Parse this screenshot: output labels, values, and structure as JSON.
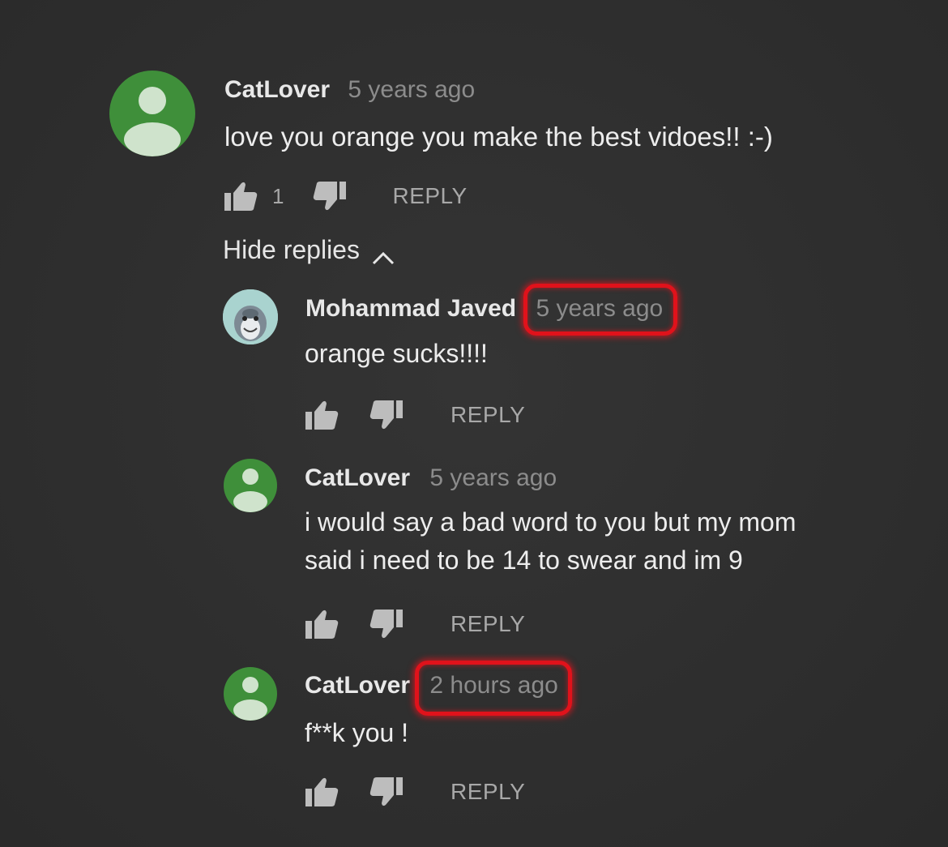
{
  "comments": [
    {
      "author": "CatLover",
      "time": "5 years ago",
      "text": "love you orange you make the best vidoes!! :-)",
      "like_count": "1",
      "reply_label": "REPLY",
      "avatar": "default-user-avatar"
    }
  ],
  "hide_replies_label": "Hide replies",
  "replies": [
    {
      "author": "Mohammad Javed",
      "time": "5 years ago",
      "text_lines": [
        "orange sucks!!!!"
      ],
      "reply_label": "REPLY",
      "avatar": "dolphin-photo-avatar",
      "time_highlighted": true
    },
    {
      "author": "CatLover",
      "time": "5 years ago",
      "text_lines": [
        "i would say a bad word to you but my mom",
        "said i need to be 14 to swear and im 9"
      ],
      "reply_label": "REPLY",
      "avatar": "default-user-avatar",
      "time_highlighted": false
    },
    {
      "author": "CatLover",
      "time": "2 hours ago",
      "text_lines": [
        "f**k you !"
      ],
      "reply_label": "REPLY",
      "avatar": "default-user-avatar",
      "time_highlighted": true
    }
  ],
  "colors": {
    "background": "#2f2f2f",
    "avatar_green": "#3f8f3a",
    "highlight_red": "#e0121b",
    "meta_gray": "#8c8c8c"
  }
}
